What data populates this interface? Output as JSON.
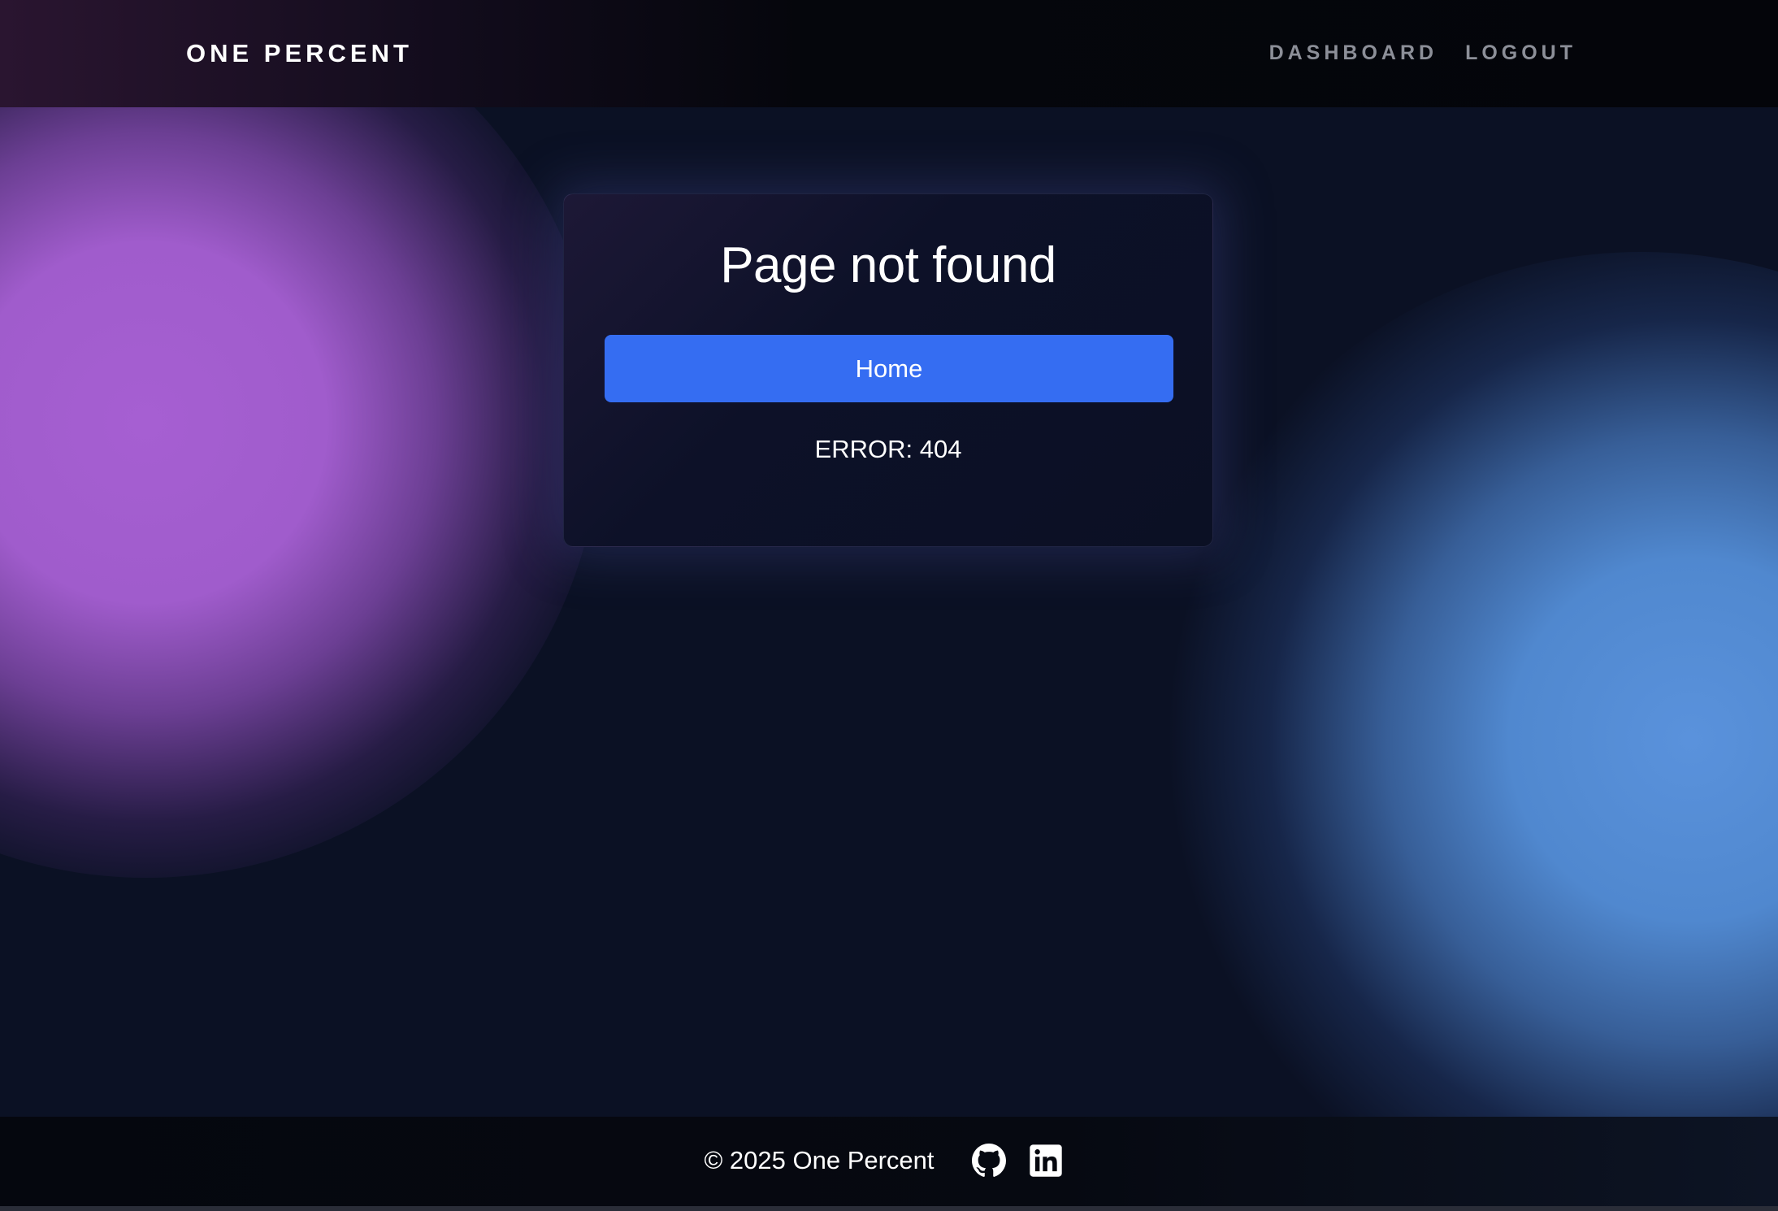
{
  "header": {
    "brand": "ONE PERCENT",
    "nav": {
      "dashboard": "DASHBOARD",
      "logout": "LOGOUT"
    }
  },
  "card": {
    "title": "Page not found",
    "home_label": "Home",
    "error_text": "ERROR: 404"
  },
  "footer": {
    "copyright": "© 2025 One Percent",
    "icons": [
      "github-icon",
      "linkedin-icon"
    ]
  },
  "colors": {
    "background": "#0b1124",
    "accent_button": "#356df2",
    "blob_purple": "#a05ccc",
    "blob_blue": "#5088cf",
    "nav_text": "#8c8f98"
  }
}
